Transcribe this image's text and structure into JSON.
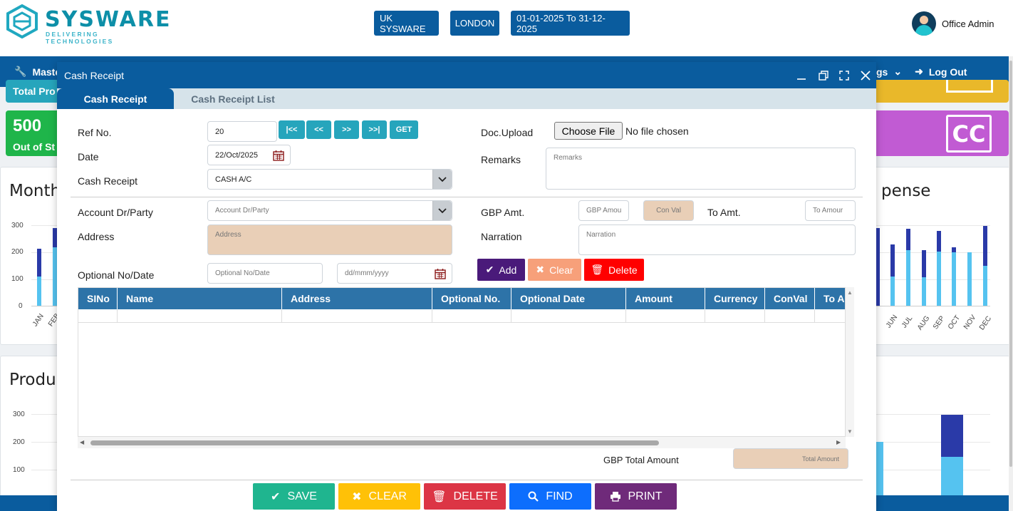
{
  "header": {
    "brand": "SYSWARE",
    "tagline": "DELIVERING TECHNOLOGIES",
    "company": "UK SYSWARE",
    "branch": "LONDON",
    "period": "01-01-2025 To 31-12-2025",
    "user": "Office Admin"
  },
  "nav": {
    "left_label": "Maste",
    "right_label": "gs",
    "logout": "Log Out"
  },
  "dashboard": {
    "tile1_label": "Total Pro",
    "tile2_value": "500",
    "tile2_label": "Out of St",
    "tile_cc": "CC",
    "monthly_title": "Month",
    "expense_title": "pense",
    "product_title": "Produ",
    "y_ticks": [
      "300",
      "200",
      "100",
      "0"
    ],
    "y_ticks2": [
      "300",
      "200",
      "100"
    ],
    "months_left": [
      "JAN",
      "FEB"
    ],
    "months_right": [
      "JUN",
      "JUL",
      "AUG",
      "SEP",
      "OCT",
      "NOV",
      "DEC"
    ],
    "colors": {
      "dark_bar": "#2a3aa8",
      "light_bar": "#55c3f0"
    }
  },
  "modal": {
    "title": "Cash Receipt",
    "tabs": [
      "Cash Receipt",
      "Cash Receipt List"
    ],
    "labels": {
      "ref_no": "Ref No.",
      "date": "Date",
      "cash_receipt": "Cash Receipt",
      "doc_upload": "Doc.Upload",
      "remarks": "Remarks",
      "account": "Account Dr/Party",
      "address": "Address",
      "optional": "Optional No/Date",
      "gbp_amt": "GBP Amt.",
      "to_amt": "To Amt.",
      "narration": "Narration",
      "gbp_total": "GBP Total Amount"
    },
    "values": {
      "ref_no": "20",
      "date": "22/Oct/2025",
      "cash_receipt": "CASH A/C",
      "no_file": "No file chosen"
    },
    "placeholders": {
      "remarks": "Remarks",
      "account": "Account Dr/Party",
      "address": "Address",
      "optional_no": "Optional No/Date",
      "optional_date": "dd/mmm/yyyy",
      "gbp_amt": "GBP Amou",
      "con_val": "Con Val",
      "to_amt": "To Amour",
      "narration": "Narration",
      "total": "Total Amount"
    },
    "nav_buttons": [
      "|<<",
      "<<",
      ">>",
      ">>|",
      "GET"
    ],
    "choose_file": "Choose File",
    "action_buttons": {
      "add": "Add",
      "clear": "Clear",
      "delete": "Delete"
    },
    "grid_columns": [
      "SINo",
      "Name",
      "Address",
      "Optional No.",
      "Optional Date",
      "Amount",
      "Currency",
      "ConVal",
      "To Am"
    ],
    "footer_buttons": {
      "save": "SAVE",
      "clear": "CLEAR",
      "delete": "DELETE",
      "find": "FIND",
      "print": "PRINT"
    },
    "colors": {
      "add": "#4a1a7a",
      "clear": "#f7a07a",
      "delete": "#ff0000",
      "save": "#1fb58f",
      "clear_footer": "#ffc107",
      "delete_footer": "#dc3545",
      "find": "#0d6efd",
      "print": "#6f2a7a"
    }
  }
}
